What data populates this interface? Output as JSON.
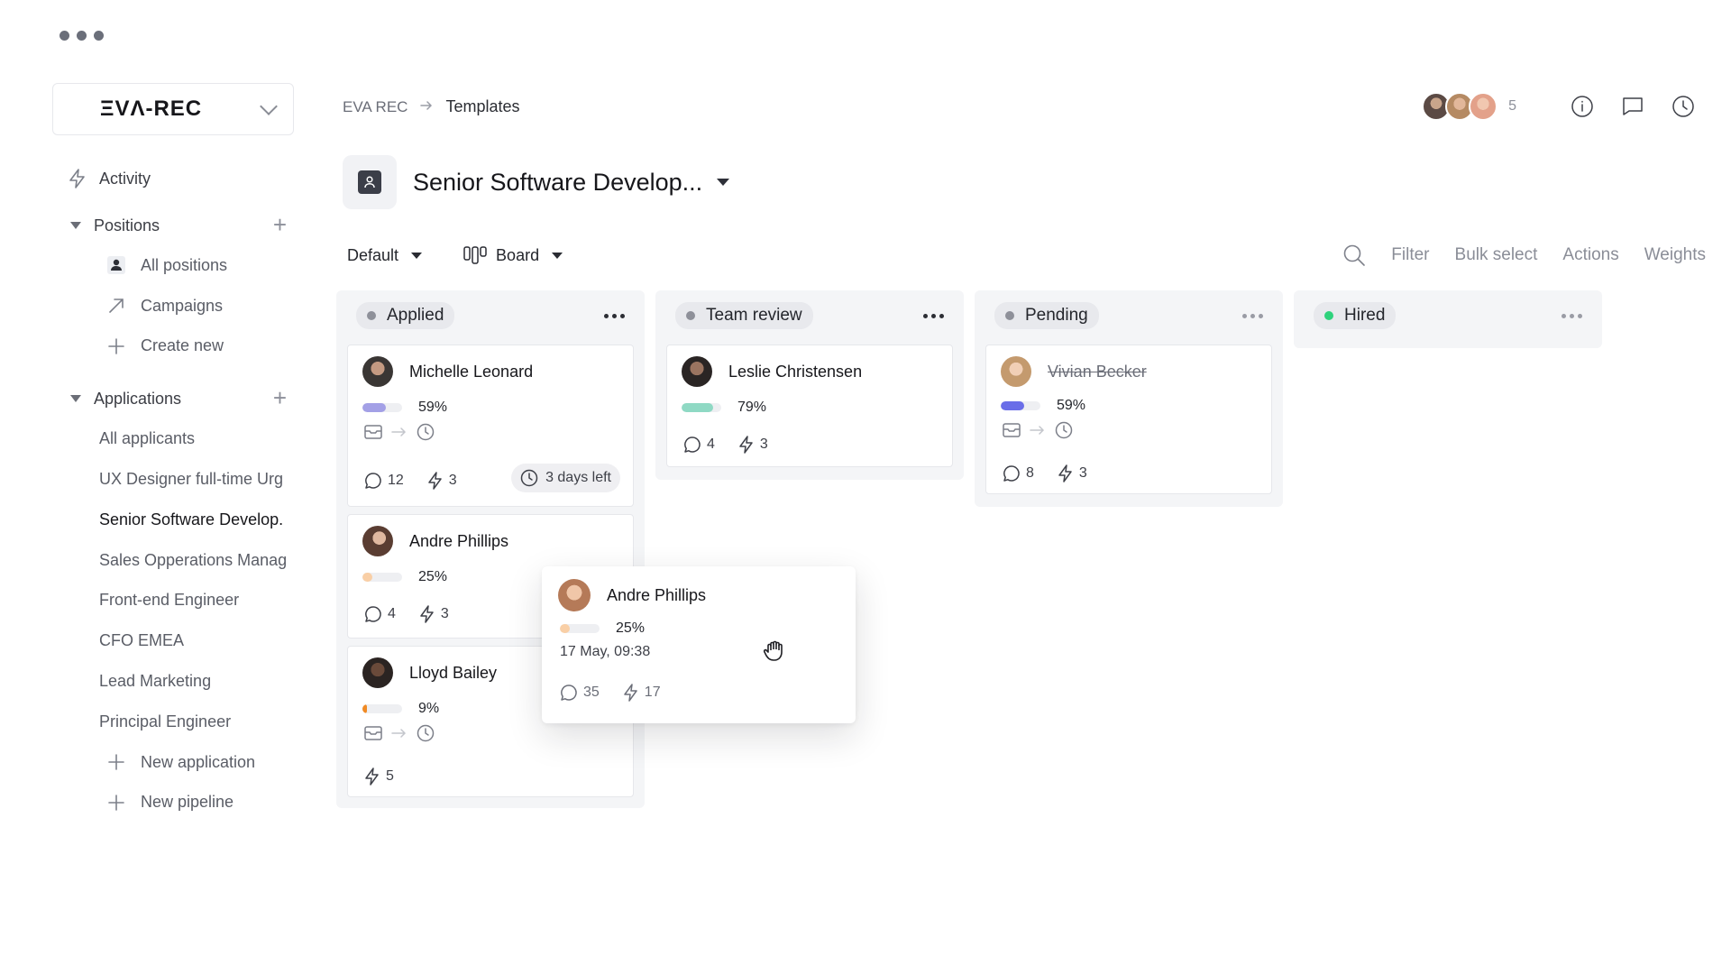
{
  "brand": {
    "name": "ΞVΛ-REC"
  },
  "sidebar": {
    "activity": "Activity",
    "positions": {
      "label": "Positions",
      "items": [
        "All positions",
        "Campaigns",
        "Create new"
      ]
    },
    "applications": {
      "label": "Applications",
      "items": [
        "All applicants",
        "UX Designer full-time Urg",
        "Senior Software Develop.",
        "Sales Opperations Manag",
        "Front-end Engineer",
        "CFO EMEA",
        "Lead Marketing",
        "Principal Engineer"
      ],
      "actions": [
        "New application",
        "New pipeline"
      ]
    }
  },
  "breadcrumb": {
    "root": "EVA REC",
    "current": "Templates"
  },
  "header": {
    "collaborator_count": "5"
  },
  "page": {
    "title": "Senior Software Develop..."
  },
  "toolbar": {
    "view": "Default",
    "layout": "Board",
    "actions": [
      "Filter",
      "Bulk select",
      "Actions",
      "Weights"
    ]
  },
  "columns": [
    {
      "name": "Applied",
      "status_color": "#8e9099"
    },
    {
      "name": "Team review",
      "status_color": "#8e9099"
    },
    {
      "name": "Pending",
      "status_color": "#8e9099"
    },
    {
      "name": "Hired",
      "status_color": "#2fd27c"
    }
  ],
  "cards": {
    "michelle": {
      "name": "Michelle Leonard",
      "progress": "59%",
      "progress_value": 0.59,
      "bar_color": "#a3a0e6",
      "comments": "12",
      "activity": "3",
      "deadline": "3 days left"
    },
    "andre": {
      "name": "Andre Phillips",
      "progress": "25%",
      "progress_value": 0.25,
      "bar_color": "#f9cfa6",
      "comments": "4",
      "activity": "3"
    },
    "lloyd": {
      "name": "Lloyd Bailey",
      "progress": "9%",
      "progress_value": 0.09,
      "bar_color": "#f08a24",
      "activity": "5"
    },
    "leslie": {
      "name": "Leslie Christensen",
      "progress": "79%",
      "progress_value": 0.79,
      "bar_color": "#8fd9c4",
      "comments": "4",
      "activity": "3"
    },
    "vivian": {
      "name": "Vivian Becker",
      "progress": "59%",
      "progress_value": 0.59,
      "bar_color": "#6a6ee8",
      "comments": "8",
      "activity": "3"
    },
    "dragging": {
      "name": "Andre Phillips",
      "progress": "25%",
      "progress_value": 0.25,
      "bar_color": "#f9cfa6",
      "date": "17 May, 09:38",
      "comments": "35",
      "activity": "17"
    }
  }
}
